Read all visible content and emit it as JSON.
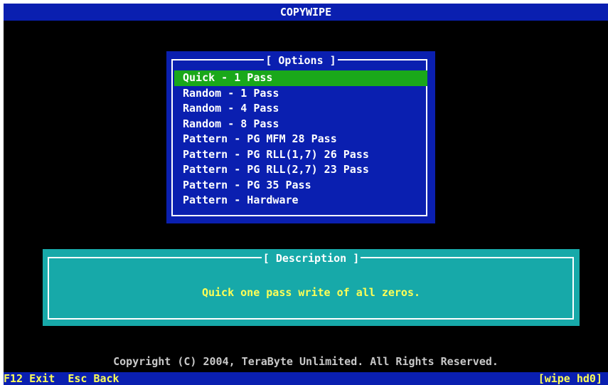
{
  "app": {
    "title": "COPYWIPE"
  },
  "options": {
    "title": "[ Options ]",
    "selected_index": 0,
    "items": [
      "Quick - 1 Pass",
      "Random - 1 Pass",
      "Random - 4 Pass",
      "Random - 8 Pass",
      "Pattern - PG MFM 28 Pass",
      "Pattern - PG RLL(1,7) 26 Pass",
      "Pattern - PG RLL(2,7) 23 Pass",
      "Pattern - PG 35 Pass",
      "Pattern - Hardware"
    ]
  },
  "description": {
    "title": "[ Description ]",
    "text": "Quick one pass write of all zeros."
  },
  "footer": {
    "copyright": "Copyright (C) 2004, TeraByte Unlimited.  All Rights Reserved.",
    "keys": [
      {
        "key": "F12",
        "label": "Exit"
      },
      {
        "key": "Esc",
        "label": "Back"
      }
    ],
    "status": "[wipe hd0]"
  },
  "colors": {
    "screen_bg": "#000000",
    "panel_blue": "#0a1fb0",
    "selection_green": "#1aa81a",
    "description_cyan": "#17a9a9",
    "highlight_yellow": "#ffff55"
  }
}
